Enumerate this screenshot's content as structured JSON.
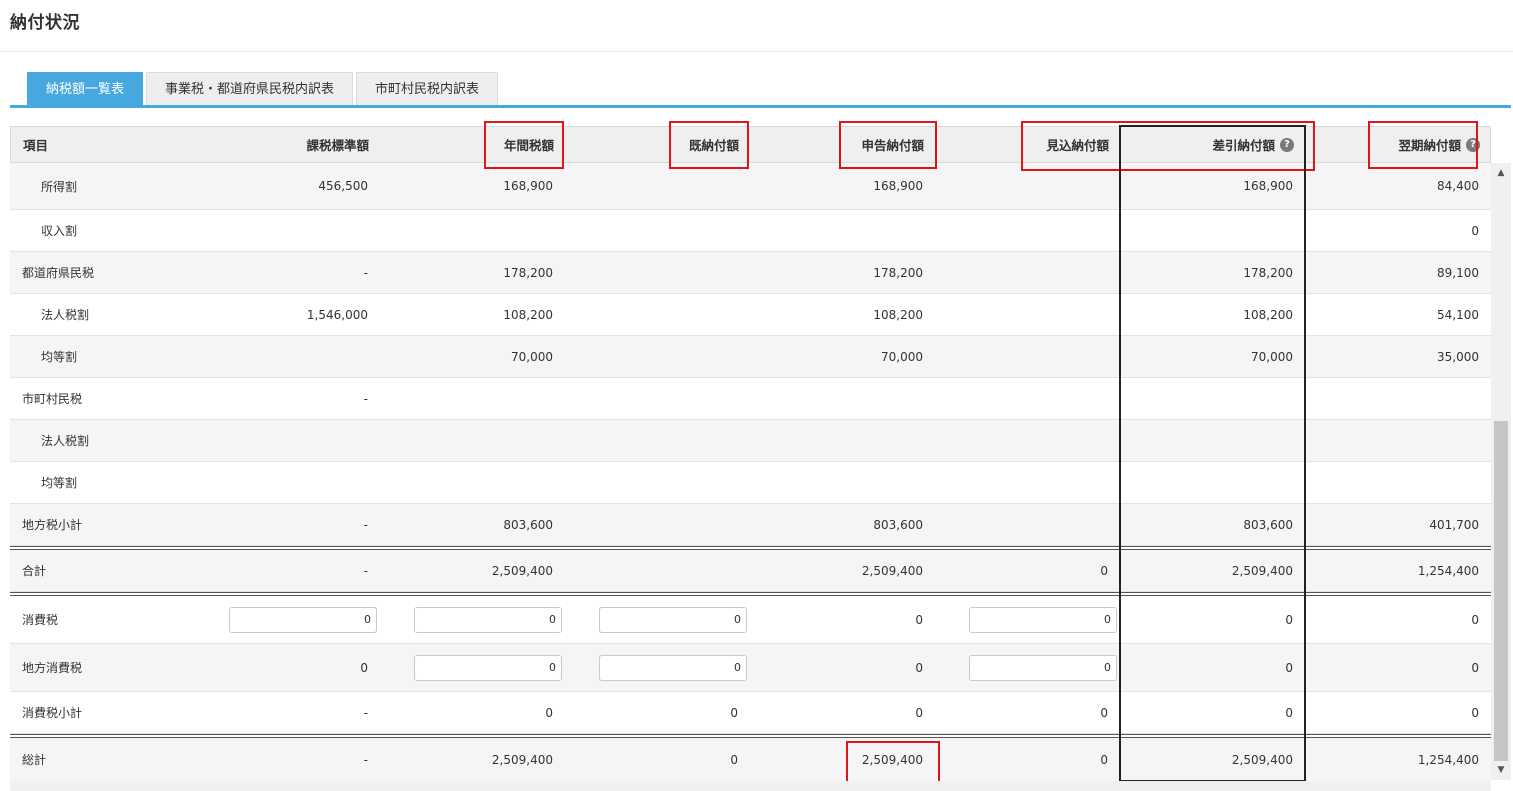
{
  "page": {
    "title": "納付状況"
  },
  "tabs": [
    {
      "label": "納税額一覧表",
      "active": true
    },
    {
      "label": "事業税・都道府県民税内訳表",
      "active": false
    },
    {
      "label": "市町村民税内訳表",
      "active": false
    }
  ],
  "columns": {
    "item": "項目",
    "base": "課税標準額",
    "annual": "年間税額",
    "paid": "既納付額",
    "declared": "申告納付額",
    "estimated": "見込納付額",
    "diff": "差引納付額",
    "next": "翌期納付額"
  },
  "rows": [
    {
      "label": "所得割",
      "base": "456,500",
      "annual": "168,900",
      "paid": "",
      "declared": "168,900",
      "estimated": "",
      "diff": "168,900",
      "next": "84,400"
    },
    {
      "label": "収入割",
      "base": "",
      "annual": "",
      "paid": "",
      "declared": "",
      "estimated": "",
      "diff": "",
      "next": "0"
    },
    {
      "label": "都道府県民税",
      "base": "-",
      "annual": "178,200",
      "paid": "",
      "declared": "178,200",
      "estimated": "",
      "diff": "178,200",
      "next": "89,100"
    },
    {
      "label": "法人税割",
      "base": "1,546,000",
      "annual": "108,200",
      "paid": "",
      "declared": "108,200",
      "estimated": "",
      "diff": "108,200",
      "next": "54,100"
    },
    {
      "label": "均等割",
      "base": "",
      "annual": "70,000",
      "paid": "",
      "declared": "70,000",
      "estimated": "",
      "diff": "70,000",
      "next": "35,000"
    },
    {
      "label": "市町村民税",
      "base": "-",
      "annual": "",
      "paid": "",
      "declared": "",
      "estimated": "",
      "diff": "",
      "next": ""
    },
    {
      "label": "法人税割",
      "base": "",
      "annual": "",
      "paid": "",
      "declared": "",
      "estimated": "",
      "diff": "",
      "next": ""
    },
    {
      "label": "均等割",
      "base": "",
      "annual": "",
      "paid": "",
      "declared": "",
      "estimated": "",
      "diff": "",
      "next": ""
    },
    {
      "label": "地方税小計",
      "base": "-",
      "annual": "803,600",
      "paid": "",
      "declared": "803,600",
      "estimated": "",
      "diff": "803,600",
      "next": "401,700"
    },
    {
      "label": "合計",
      "base": "-",
      "annual": "2,509,400",
      "paid": "",
      "declared": "2,509,400",
      "estimated": "0",
      "diff": "2,509,400",
      "next": "1,254,400"
    },
    {
      "label": "消費税",
      "base": "0",
      "annual": "0",
      "paid": "0",
      "declared": "0",
      "estimated": "0",
      "diff": "0",
      "next": "0"
    },
    {
      "label": "地方消費税",
      "base": "0",
      "annual": "0",
      "paid": "0",
      "declared": "0",
      "estimated": "0",
      "diff": "0",
      "next": "0"
    },
    {
      "label": "消費税小計",
      "base": "-",
      "annual": "0",
      "paid": "0",
      "declared": "0",
      "estimated": "0",
      "diff": "0",
      "next": "0"
    },
    {
      "label": "総計",
      "base": "-",
      "annual": "2,509,400",
      "paid": "0",
      "declared": "2,509,400",
      "estimated": "0",
      "diff": "2,509,400",
      "next": "1,254,400"
    }
  ],
  "icons": {
    "help": "question-circle-icon",
    "scroll_up": "triangle-up-icon",
    "scroll_down": "triangle-down-icon"
  },
  "colors": {
    "accent": "#47a8e0",
    "highlight_red": "#e0151c",
    "highlight_black": "#222222"
  }
}
